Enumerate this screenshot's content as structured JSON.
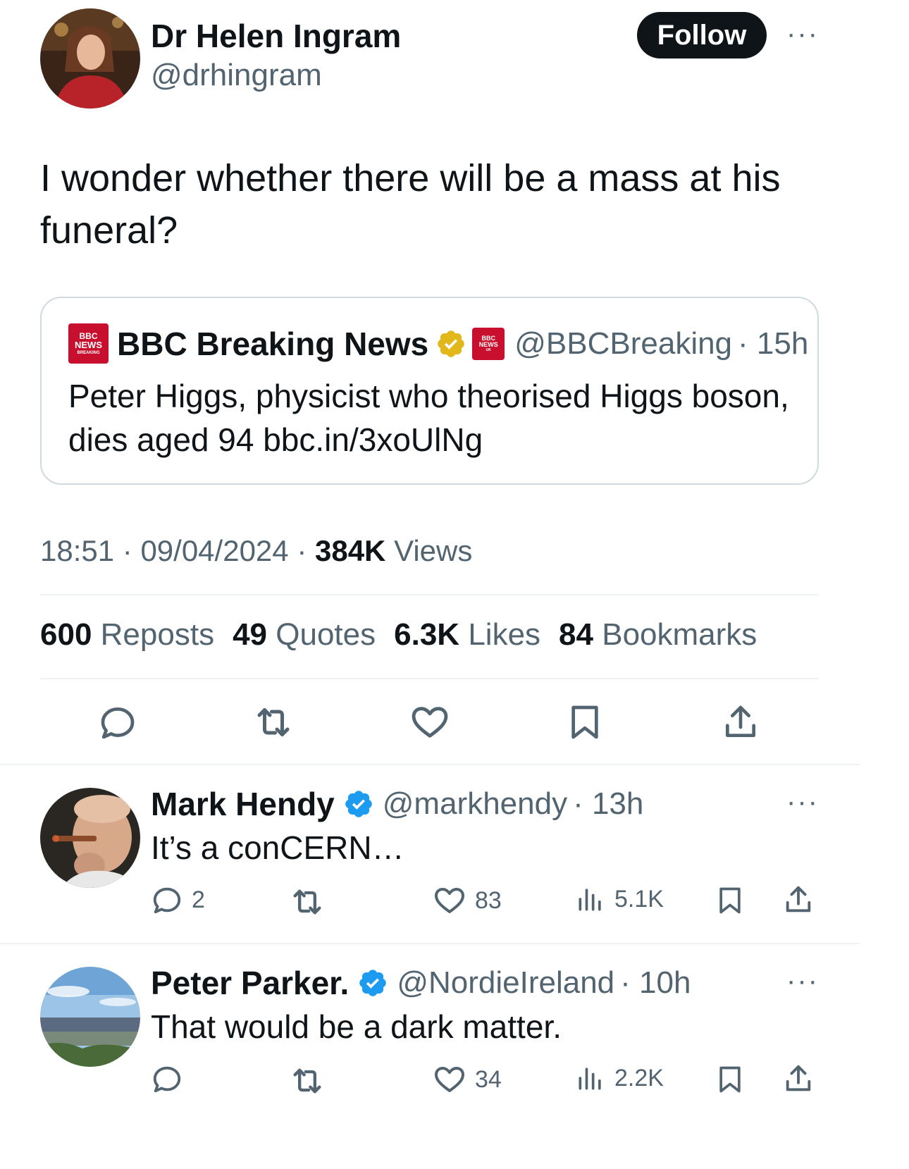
{
  "tweet": {
    "author_name": "Dr Helen Ingram",
    "author_handle": "@drhingram",
    "follow_label": "Follow",
    "more_label": "···",
    "text": "I wonder whether there will be a mass at his funeral?",
    "quote": {
      "name": "BBC Breaking News",
      "handle": "@BBCBreaking",
      "time": "· 15h",
      "text": "Peter Higgs, physicist who theorised Higgs boson, dies aged 94 bbc.in/3xoUlNg",
      "logo_line1": "BBC",
      "logo_line2": "NEWS",
      "logo_line3": "BREAKING",
      "badge_line1": "BBC",
      "badge_line2": "NEWS",
      "badge_line3": "UK"
    },
    "time": "18:51",
    "date": "09/04/2024",
    "views_count": "384K",
    "views_label": "Views",
    "stats": {
      "reposts_count": "600",
      "reposts_label": "Reposts",
      "quotes_count": "49",
      "quotes_label": "Quotes",
      "likes_count": "6.3K",
      "likes_label": "Likes",
      "bookmarks_count": "84",
      "bookmarks_label": "Bookmarks"
    },
    "icons": [
      "reply-icon",
      "repost-icon",
      "like-icon",
      "bookmark-icon",
      "share-icon"
    ]
  },
  "replies": [
    {
      "name": "Mark Hendy",
      "handle": "@markhendy",
      "time": "· 13h",
      "text": "It’s a conCERN…",
      "reply_count": "2",
      "like_count": "83",
      "view_count": "5.1K"
    },
    {
      "name": "Peter Parker.",
      "handle": "@NordieIreland",
      "time": "· 10h",
      "text": "That would be a dark matter.",
      "reply_count": "",
      "like_count": "34",
      "view_count": "2.2K"
    }
  ],
  "colors": {
    "text_primary": "#0f1419",
    "text_secondary": "#536471",
    "divider": "#eff3f4",
    "verified_blue": "#1d9bf0",
    "verified_gold": "#e2b719",
    "bbc_red": "#c8102e"
  }
}
